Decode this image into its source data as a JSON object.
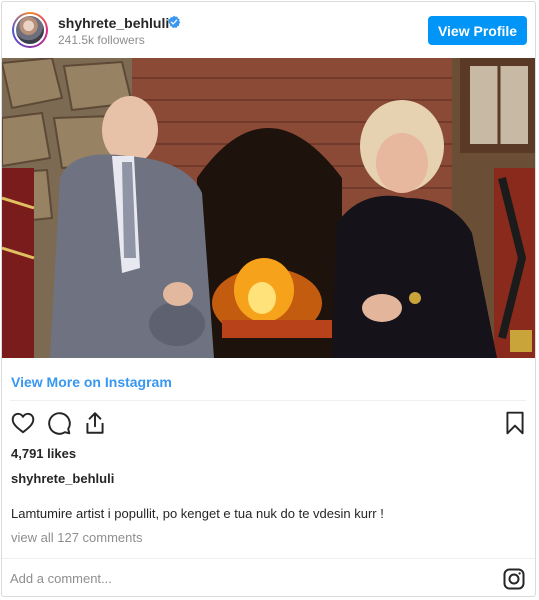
{
  "header": {
    "username": "shyhrete_behluli",
    "followers": "241.5k followers",
    "view_profile_label": "View Profile",
    "verified": true,
    "icons": [
      "avatar",
      "verified-badge-icon"
    ]
  },
  "media": {
    "type": "photo",
    "description_icon": "video-thumbnail"
  },
  "post": {
    "view_more_label": "View More on Instagram",
    "likes": "4,791 likes",
    "caption_user": "shyhrete_behluli",
    "caption_text": "Lamtumire artist i popullit, po kenget e tua nuk do te vdesin kurr !",
    "comments_link": "view all 127 comments",
    "comment_placeholder": "Add a comment...",
    "action_icons": [
      "heart-icon",
      "comment-icon",
      "share-icon",
      "bookmark-icon"
    ]
  },
  "colors": {
    "accent": "#0095f6",
    "link": "#3897f0",
    "muted": "#8e8e8e",
    "text": "#262626",
    "border": "#dbdbdb"
  }
}
